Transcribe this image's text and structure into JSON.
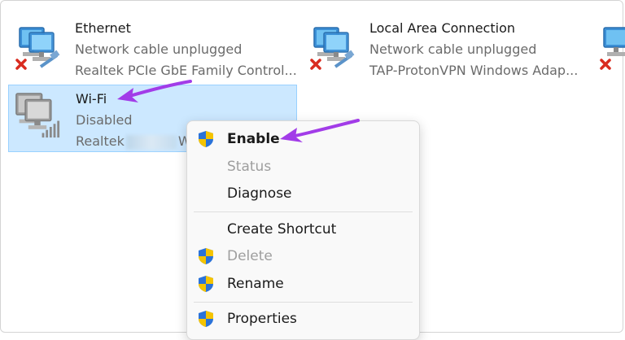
{
  "connections": [
    {
      "id": "ethernet",
      "name": "Ethernet",
      "status": "Network cable unplugged",
      "adapter": "Realtek PCIe GbE Family Control...",
      "icon": "network-adapter-unplugged-icon"
    },
    {
      "id": "lan",
      "name": "Local Area Connection",
      "status": "Network cable unplugged",
      "adapter": "TAP-ProtonVPN Windows Adap...",
      "icon": "network-adapter-unplugged-icon"
    },
    {
      "id": "wifi",
      "name": "Wi-Fi",
      "status": "Disabled",
      "adapter_prefix": "Realtek",
      "adapter_suffix": "W",
      "icon": "wifi-adapter-disabled-icon",
      "selected": true
    }
  ],
  "context_menu": {
    "items": [
      {
        "label": "Enable",
        "bold": true,
        "disabled": false,
        "shield": true
      },
      {
        "label": "Status",
        "bold": false,
        "disabled": true,
        "shield": false
      },
      {
        "label": "Diagnose",
        "bold": false,
        "disabled": false,
        "shield": false
      },
      {
        "label": "Create Shortcut",
        "bold": false,
        "disabled": false,
        "shield": false
      },
      {
        "label": "Delete",
        "bold": false,
        "disabled": true,
        "shield": true
      },
      {
        "label": "Rename",
        "bold": false,
        "disabled": false,
        "shield": true
      },
      {
        "label": "Properties",
        "bold": false,
        "disabled": false,
        "shield": true
      }
    ]
  },
  "colors": {
    "selection_bg": "#cce8ff",
    "selection_border": "#99d1ff",
    "annotation_arrow": "#a23ce8",
    "error_red": "#d92b1f",
    "shield_blue": "#2b73d9",
    "shield_yellow": "#f5c400"
  }
}
